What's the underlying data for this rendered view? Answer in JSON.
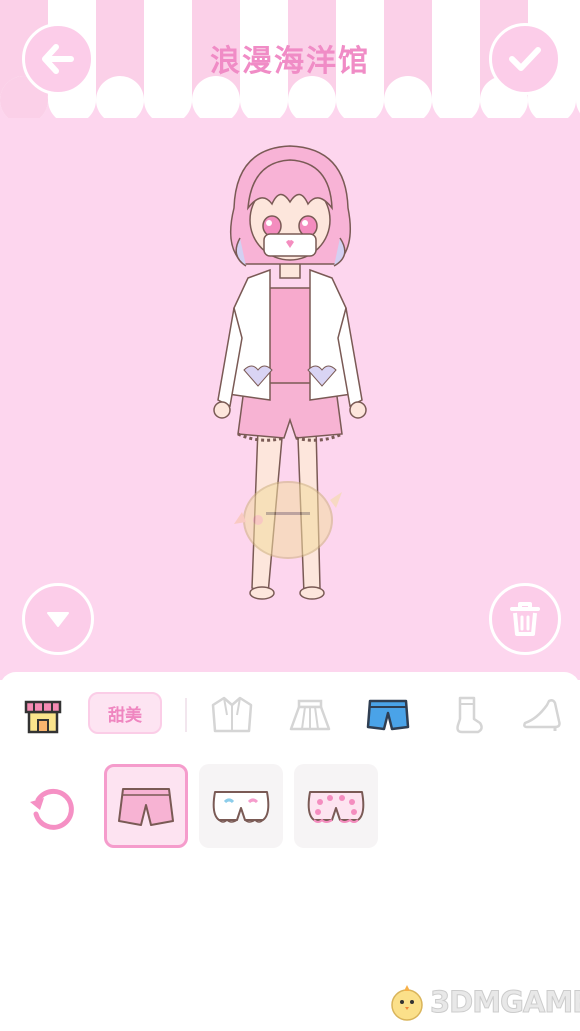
{
  "header": {
    "title": "浪漫海洋馆"
  },
  "colors": {
    "stage_bg": "#fdd6ee",
    "accent_pink": "#f08cc6",
    "selected_border": "#f59ccc",
    "selected_category_icon": "#4aa3e8"
  },
  "toolbar": {
    "back_icon": "arrow-left-icon",
    "confirm_icon": "check-icon",
    "collapse_icon": "triangle-down-icon",
    "delete_icon": "trash-icon"
  },
  "categories": {
    "shop_icon": "shop-icon",
    "style_tag": "甜美",
    "items": [
      {
        "icon": "jacket-icon",
        "selected": false
      },
      {
        "icon": "skirt-icon",
        "selected": false
      },
      {
        "icon": "shorts-icon",
        "selected": true
      },
      {
        "icon": "sock-icon",
        "selected": false
      },
      {
        "icon": "high-heel-icon",
        "selected": false
      }
    ]
  },
  "wardrobe": {
    "reset_icon": "reset-icon",
    "items": [
      {
        "name": "pink shorts",
        "selected": true
      },
      {
        "name": "white bloomers",
        "selected": false
      },
      {
        "name": "pink polka bloomers",
        "selected": false
      }
    ]
  },
  "watermark": {
    "text": "3DMGAME"
  }
}
